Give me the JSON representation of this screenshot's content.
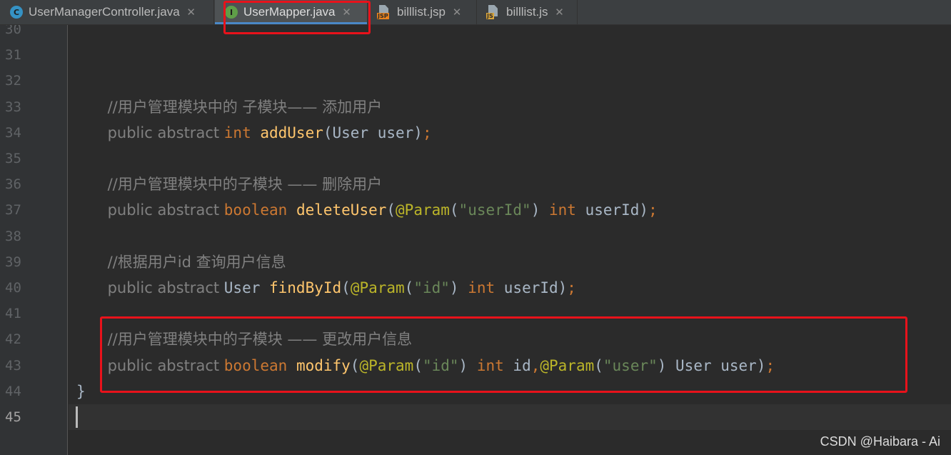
{
  "tabs": [
    {
      "label": "UserManagerController.java",
      "icon": "class-icon",
      "icon_letter": "C",
      "active": false
    },
    {
      "label": "UserMapper.java",
      "icon": "interface-icon",
      "icon_letter": "I",
      "active": true
    },
    {
      "label": "billlist.jsp",
      "icon": "jsp-file-icon",
      "icon_badge": "JSP",
      "active": false
    },
    {
      "label": "billlist.js",
      "icon": "js-file-icon",
      "icon_badge": "JS",
      "active": false
    }
  ],
  "close_glyph": "✕",
  "line_numbers": [
    "30",
    "31",
    "32",
    "33",
    "34",
    "35",
    "36",
    "37",
    "38",
    "39",
    "40",
    "41",
    "42",
    "43",
    "44",
    "45"
  ],
  "current_line": "45",
  "code": [
    {
      "line": "30",
      "tokens": []
    },
    {
      "line": "31",
      "tokens": []
    },
    {
      "line": "32",
      "tokens": []
    },
    {
      "line": "33",
      "tokens": [
        {
          "t": "    ",
          "k": "plain"
        },
        {
          "t": "//用户管理模块中的 子模块—— 添加用户",
          "k": "comment"
        }
      ]
    },
    {
      "line": "34",
      "tokens": [
        {
          "t": "    ",
          "k": "plain"
        },
        {
          "t": "public abstract ",
          "k": "comment"
        },
        {
          "t": "int ",
          "k": "kw"
        },
        {
          "t": "addUser",
          "k": "fn"
        },
        {
          "t": "(User user)",
          "k": "plain"
        },
        {
          "t": ";",
          "k": "punct"
        }
      ]
    },
    {
      "line": "35",
      "tokens": []
    },
    {
      "line": "36",
      "tokens": [
        {
          "t": "    ",
          "k": "plain"
        },
        {
          "t": "//用户管理模块中的子模块 —— 删除用户",
          "k": "comment"
        }
      ]
    },
    {
      "line": "37",
      "tokens": [
        {
          "t": "    ",
          "k": "plain"
        },
        {
          "t": "public abstract ",
          "k": "comment"
        },
        {
          "t": "boolean ",
          "k": "kw"
        },
        {
          "t": "deleteUser",
          "k": "fn"
        },
        {
          "t": "(",
          "k": "plain"
        },
        {
          "t": "@Param",
          "k": "ann"
        },
        {
          "t": "(",
          "k": "plain"
        },
        {
          "t": "\"userId\"",
          "k": "str"
        },
        {
          "t": ") ",
          "k": "plain"
        },
        {
          "t": "int ",
          "k": "kw"
        },
        {
          "t": "userId)",
          "k": "plain"
        },
        {
          "t": ";",
          "k": "punct"
        }
      ]
    },
    {
      "line": "38",
      "tokens": []
    },
    {
      "line": "39",
      "tokens": [
        {
          "t": "    ",
          "k": "plain"
        },
        {
          "t": "//根据用户id 查询用户信息",
          "k": "comment"
        }
      ]
    },
    {
      "line": "40",
      "tokens": [
        {
          "t": "    ",
          "k": "plain"
        },
        {
          "t": "public abstract ",
          "k": "comment"
        },
        {
          "t": "User ",
          "k": "plain"
        },
        {
          "t": "findById",
          "k": "fn"
        },
        {
          "t": "(",
          "k": "plain"
        },
        {
          "t": "@Param",
          "k": "ann"
        },
        {
          "t": "(",
          "k": "plain"
        },
        {
          "t": "\"id\"",
          "k": "str"
        },
        {
          "t": ") ",
          "k": "plain"
        },
        {
          "t": "int ",
          "k": "kw"
        },
        {
          "t": "userId)",
          "k": "plain"
        },
        {
          "t": ";",
          "k": "punct"
        }
      ]
    },
    {
      "line": "41",
      "tokens": []
    },
    {
      "line": "42",
      "tokens": [
        {
          "t": "    ",
          "k": "plain"
        },
        {
          "t": "//用户管理模块中的子模块 —— 更改用户信息",
          "k": "comment"
        }
      ]
    },
    {
      "line": "43",
      "tokens": [
        {
          "t": "    ",
          "k": "plain"
        },
        {
          "t": "public abstract ",
          "k": "comment"
        },
        {
          "t": "boolean ",
          "k": "kw"
        },
        {
          "t": "modify",
          "k": "fn"
        },
        {
          "t": "(",
          "k": "plain"
        },
        {
          "t": "@Param",
          "k": "ann"
        },
        {
          "t": "(",
          "k": "plain"
        },
        {
          "t": "\"id\"",
          "k": "str"
        },
        {
          "t": ") ",
          "k": "plain"
        },
        {
          "t": "int ",
          "k": "kw"
        },
        {
          "t": "id",
          "k": "plain"
        },
        {
          "t": ",",
          "k": "punct"
        },
        {
          "t": "@Param",
          "k": "ann"
        },
        {
          "t": "(",
          "k": "plain"
        },
        {
          "t": "\"user\"",
          "k": "str"
        },
        {
          "t": ") User user)",
          "k": "plain"
        },
        {
          "t": ";",
          "k": "punct"
        }
      ]
    },
    {
      "line": "44",
      "tokens": [
        {
          "t": "}",
          "k": "plain"
        }
      ]
    },
    {
      "line": "45",
      "tokens": []
    }
  ],
  "watermark": "CSDN @Haibara - Ai",
  "colors": {
    "background": "#2b2b2b",
    "gutter": "#313335",
    "comment": "#808080",
    "keyword": "#cc7832",
    "function": "#ffc66d",
    "annotation": "#bbb529",
    "string": "#6a8759",
    "plain": "#a9b7c6",
    "active_tab_underline": "#4a88c7",
    "highlight_box": "#e8121b"
  }
}
